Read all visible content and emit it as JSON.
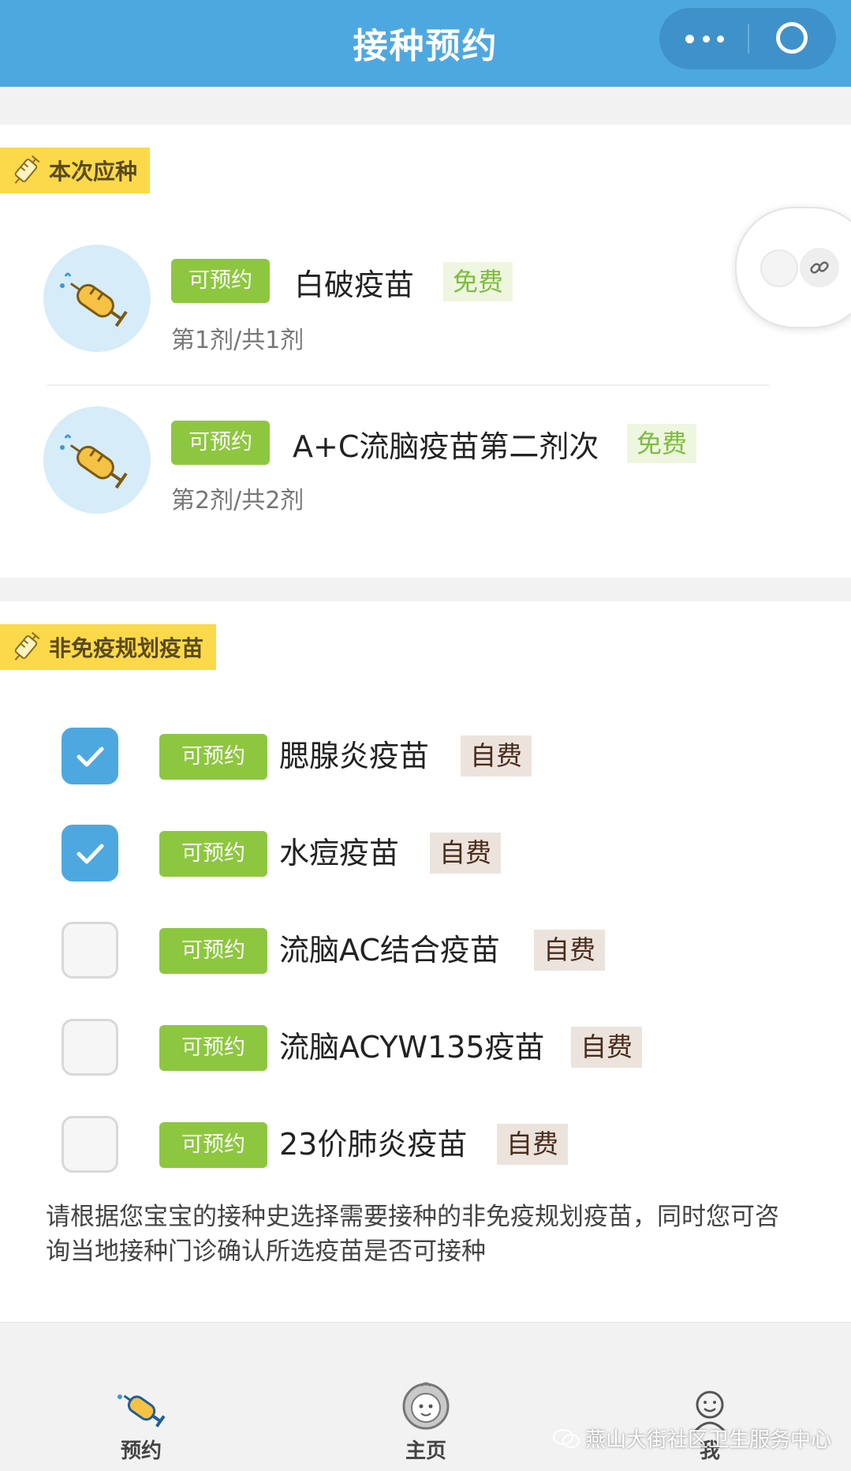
{
  "header": {
    "title": "接种预约",
    "menu_icon": "more-dots-icon",
    "close_icon": "circle-close-icon"
  },
  "scheduled": {
    "section_title": "本次应种",
    "items": [
      {
        "status": "可预约",
        "name": "白破疫苗",
        "fee": "免费",
        "dose": "第1剂/共1剂"
      },
      {
        "status": "可预约",
        "name": "A+C流脑疫苗第二剂次",
        "fee": "免费",
        "dose": "第2剂/共2剂"
      }
    ]
  },
  "optional": {
    "section_title": "非免疫规划疫苗",
    "items": [
      {
        "checked": true,
        "status": "可预约",
        "name": "腮腺炎疫苗",
        "fee": "自费"
      },
      {
        "checked": true,
        "status": "可预约",
        "name": "水痘疫苗",
        "fee": "自费"
      },
      {
        "checked": false,
        "status": "可预约",
        "name": "流脑AC结合疫苗",
        "fee": "自费"
      },
      {
        "checked": false,
        "status": "可预约",
        "name": "流脑ACYW135疫苗",
        "fee": "自费"
      },
      {
        "checked": false,
        "status": "可预约",
        "name": "23价肺炎疫苗",
        "fee": "自费"
      }
    ],
    "notice": "请根据您宝宝的接种史选择需要接种的非免疫规划疫苗，同时您可咨询当地接种门诊确认所选疫苗是否可接种"
  },
  "tabbar": {
    "tabs": [
      {
        "label": "预约",
        "icon": "syringe-icon"
      },
      {
        "label": "主页",
        "icon": "baby-face-icon"
      },
      {
        "label": "我",
        "icon": "smiley-person-icon"
      }
    ]
  },
  "watermark": "燕山大街社区卫生服务中心",
  "colors": {
    "header": "#4ea8e0",
    "available_badge": "#8dc73f",
    "section_tag": "#fbd94a",
    "checkbox_checked": "#4ea8e0",
    "free_text": "#7cbd3b"
  }
}
